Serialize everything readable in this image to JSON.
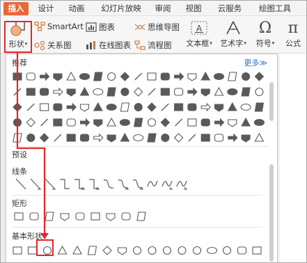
{
  "menu": {
    "tabs": [
      "插入",
      "设计",
      "动画",
      "幻灯片放映",
      "审阅",
      "视图",
      "云服务",
      "绘图工具"
    ],
    "active_tab": "插入"
  },
  "ribbon": {
    "shape_label": "形状",
    "smartart_label": "SmartArt",
    "chart_label": "图表",
    "mindmap_label": "思维导图",
    "relation_label": "关系图",
    "online_chart_label": "在线图表",
    "flowchart_label": "流程图",
    "textbox_label": "文本框",
    "arttext_label": "艺术字",
    "symbol_label": "符号",
    "formula_label": "公式"
  },
  "panel": {
    "recommended_title": "推荐",
    "more_label": "更多≫",
    "preset_title": "预设",
    "lines_title": "线条",
    "rect_title": "矩形",
    "basic_title": "基本形状"
  },
  "colors": {
    "accent": "#e8683c",
    "highlight_red": "#e0262c",
    "link_blue": "#2f6fd0",
    "shape_grey": "#5a5a5a"
  }
}
